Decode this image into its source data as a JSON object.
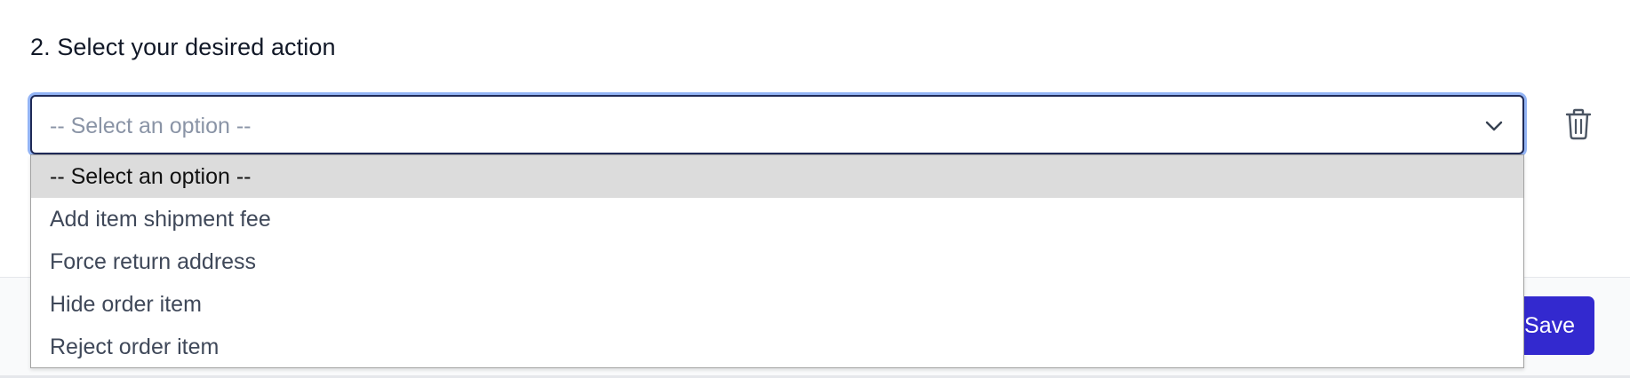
{
  "section": {
    "title": "2. Select your desired action"
  },
  "action_select": {
    "value": "-- Select an option --",
    "options": [
      "-- Select an option --",
      "Add item shipment fee",
      "Force return address",
      "Hide order item",
      "Reject order item"
    ],
    "selected_index": 0
  },
  "footer": {
    "save_label": "Save"
  },
  "icons": {
    "dropdown": "chevron-down-icon",
    "delete": "trash-icon"
  },
  "colors": {
    "accent": "#3329cf",
    "focus_ring": "#93b4f5",
    "select_border": "#1f2a57",
    "highlight": "#dcdcdc"
  }
}
